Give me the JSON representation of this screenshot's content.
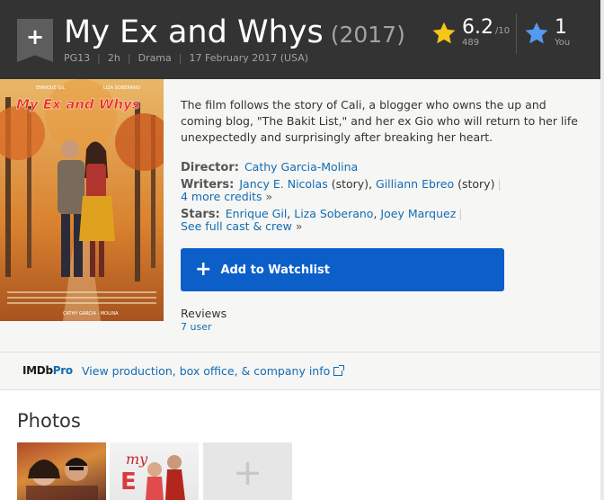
{
  "header": {
    "title": "My Ex and Whys",
    "year": "(2017)",
    "certificate": "PG13",
    "runtime": "2h",
    "genre": "Drama",
    "release": "17 February 2017 (USA)",
    "rating": "6.2",
    "rating_max": "/10",
    "rating_count": "489",
    "user_rating": "1",
    "user_label": "You",
    "colors": {
      "bar": "#333333",
      "star_gold": "#f5c518",
      "star_blue": "#5799ef"
    }
  },
  "poster": {
    "title_text": "My Ex and Whys",
    "actor_left": "ENRIQUE GIL",
    "actor_right": "LIZA SOBERANO",
    "director_credit": "CATHY GARCIA - MOLINA"
  },
  "summary": "The film follows the story of Cali, a blogger who owns the up and coming blog, \"The Bakit List,\" and her ex Gio who will return to her life unexpectedly and surprisingly after breaking her heart.",
  "director": {
    "label": "Director:",
    "name": "Cathy Garcia-Molina"
  },
  "writers": {
    "label": "Writers:",
    "names": [
      "Jancy E. Nicolas",
      "Gilliann Ebreo"
    ],
    "role": "(story)",
    "more": "4 more credits",
    "more_arrow": "»"
  },
  "stars": {
    "label": "Stars:",
    "names": [
      "Enrique Gil",
      "Liza Soberano",
      "Joey Marquez"
    ],
    "more": "See full cast & crew",
    "more_arrow": "»"
  },
  "watchlist": {
    "plus": "+",
    "label": "Add to Watchlist",
    "color": "#0c5fc9"
  },
  "reviews": {
    "label": "Reviews",
    "count": "7 user"
  },
  "imdbpro": {
    "logo_imdb": "IMDb",
    "logo_pro": "Pro",
    "link": "View production, box office, & company info"
  },
  "photos": {
    "title": "Photos",
    "thumb2_text": "my"
  }
}
